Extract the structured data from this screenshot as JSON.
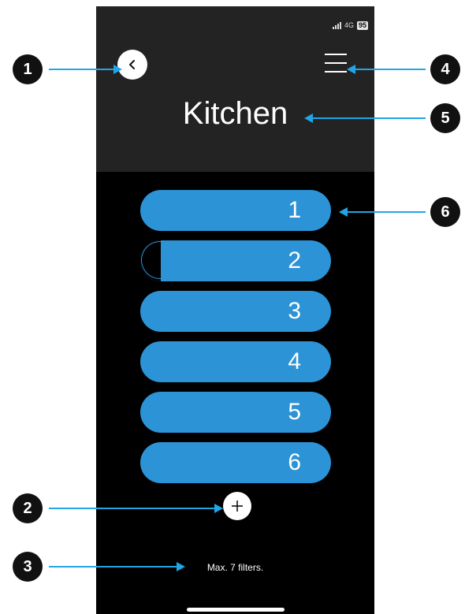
{
  "status_bar": {
    "network": "4G",
    "battery": "95"
  },
  "header": {
    "title": "Kitchen",
    "back_icon": "chevron-left-icon",
    "menu_icon": "hamburger-menu-icon"
  },
  "filters": [
    {
      "label": "1"
    },
    {
      "label": "2"
    },
    {
      "label": "3"
    },
    {
      "label": "4"
    },
    {
      "label": "5"
    },
    {
      "label": "6"
    }
  ],
  "add_button": {
    "icon": "plus-icon"
  },
  "footer_note": "Max. 7 filters.",
  "callouts": [
    "1",
    "2",
    "3",
    "4",
    "5",
    "6"
  ],
  "colors": {
    "accent": "#2c93d6",
    "header_bg": "#232323",
    "background": "#000000",
    "callout_line": "#20a6e6"
  }
}
